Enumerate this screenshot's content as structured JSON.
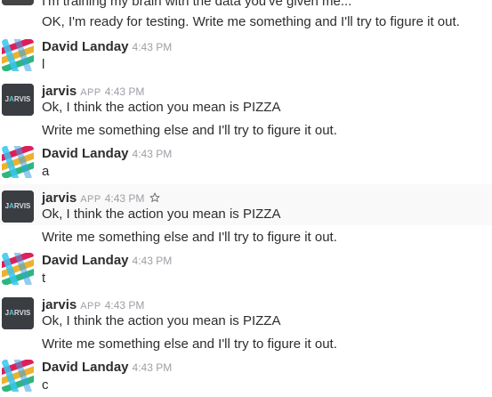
{
  "messages": [
    {
      "type": "continuation",
      "text": "I'm training my brain with the data you've given me..."
    },
    {
      "type": "continuation",
      "text": "OK, I'm ready for testing. Write me something and I'll try to figure it out."
    },
    {
      "type": "message",
      "sender": "David Landay",
      "time": "4:43 PM",
      "lines": [
        "l"
      ]
    },
    {
      "type": "message",
      "sender": "jarvis",
      "app": "APP",
      "time": "4:43 PM",
      "lines": [
        "Ok, I think the action you mean is PIZZA",
        "Write me something else and I'll try to figure it out."
      ]
    },
    {
      "type": "message",
      "sender": "David Landay",
      "time": "4:43 PM",
      "lines": [
        "a"
      ]
    },
    {
      "type": "message",
      "sender": "jarvis",
      "app": "APP",
      "time": "4:43 PM",
      "lines": [
        "Ok, I think the action you mean is PIZZA",
        "Write me something else and I'll try to figure it out."
      ]
    },
    {
      "type": "message",
      "sender": "David Landay",
      "time": "4:43 PM",
      "lines": [
        "t"
      ]
    },
    {
      "type": "message",
      "sender": "jarvis",
      "app": "APP",
      "time": "4:43 PM",
      "lines": [
        "Ok, I think the action you mean is PIZZA",
        "Write me something else and I'll try to figure it out."
      ]
    },
    {
      "type": "message",
      "sender": "David Landay",
      "time": "4:43 PM",
      "lines": [
        "c"
      ]
    }
  ],
  "jarvis_avatar_text": "JARVIS",
  "icons": {
    "star": "star-icon"
  },
  "colors": {
    "name": "#2c2d30",
    "meta": "#9e9ea6",
    "hover_bg": "#f9f9f9"
  }
}
